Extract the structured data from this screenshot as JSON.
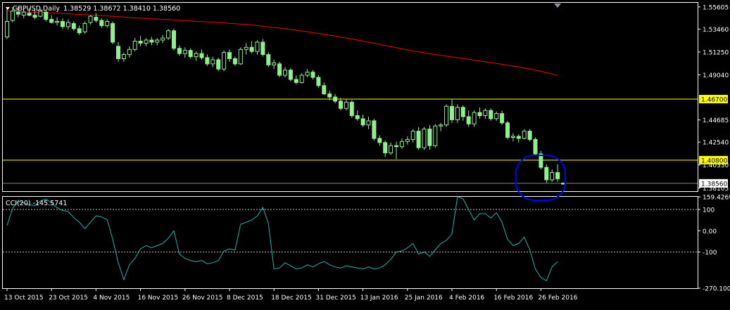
{
  "header": {
    "symbol_label": "GBPUSD,Daily",
    "ohlc_text": "1.38529 1.38672 1.38410 1.38560",
    "indicator_label": "CCI(20) -145.5741"
  },
  "colors": {
    "background": "#000000",
    "frame": "#ffffff",
    "bull_body": "#000000",
    "bear_body": "#90ee90",
    "candle_outline": "#90ee90",
    "ma_line": "#ff0000",
    "level_line": "#ffff00",
    "level_label_bg": "#ffff00",
    "cci_line": "#20b2aa",
    "ellipse": "#0000ff",
    "dotted": "#c0c0c0"
  },
  "chart_data": [
    {
      "type": "line",
      "description_visible": "Candlestick price chart with moving average",
      "title": "GBPUSD,Daily",
      "ohlc_last": {
        "open": 1.38529,
        "high": 1.38672,
        "low": 1.3841,
        "close": 1.3856
      },
      "y_range": [
        1.378,
        1.56
      ],
      "y_ticks": [
        "1.55605",
        "1.53460",
        "1.51250",
        "1.49040",
        "1.44685",
        "1.42540",
        "1.40330",
        "1.38105"
      ],
      "level_lines": [
        {
          "value": 1.467,
          "label": "1.46700"
        },
        {
          "value": 1.408,
          "label": "1.40800"
        }
      ],
      "current_price_label": "1.38560",
      "x_tick_labels": [
        {
          "index": 0,
          "label": "13 Oct 2015"
        },
        {
          "index": 8,
          "label": "23 Oct 2015"
        },
        {
          "index": 16,
          "label": "4 Nov 2015"
        },
        {
          "index": 24,
          "label": "16 Nov 2015"
        },
        {
          "index": 32,
          "label": "26 Nov 2015"
        },
        {
          "index": 40,
          "label": "8 Dec 2015"
        },
        {
          "index": 48,
          "label": "18 Dec 2015"
        },
        {
          "index": 56,
          "label": "31 Dec 2015"
        },
        {
          "index": 64,
          "label": "13 Jan 2016"
        },
        {
          "index": 72,
          "label": "25 Jan 2016"
        },
        {
          "index": 80,
          "label": "4 Feb 2016"
        },
        {
          "index": 88,
          "label": "16 Feb 2016"
        },
        {
          "index": 96,
          "label": "26 Feb 2016"
        }
      ],
      "candles": [
        {
          "o": 1.527,
          "h": 1.5545,
          "l": 1.525,
          "c": 1.542
        },
        {
          "o": 1.543,
          "h": 1.556,
          "l": 1.541,
          "c": 1.552
        },
        {
          "o": 1.551,
          "h": 1.556,
          "l": 1.546,
          "c": 1.549
        },
        {
          "o": 1.548,
          "h": 1.554,
          "l": 1.545,
          "c": 1.551
        },
        {
          "o": 1.55,
          "h": 1.555,
          "l": 1.547,
          "c": 1.548
        },
        {
          "o": 1.548,
          "h": 1.553,
          "l": 1.544,
          "c": 1.546
        },
        {
          "o": 1.547,
          "h": 1.554,
          "l": 1.546,
          "c": 1.552
        },
        {
          "o": 1.551,
          "h": 1.553,
          "l": 1.542,
          "c": 1.544
        },
        {
          "o": 1.544,
          "h": 1.548,
          "l": 1.54,
          "c": 1.541
        },
        {
          "o": 1.541,
          "h": 1.546,
          "l": 1.538,
          "c": 1.542
        },
        {
          "o": 1.542,
          "h": 1.545,
          "l": 1.535,
          "c": 1.537
        },
        {
          "o": 1.537,
          "h": 1.544,
          "l": 1.534,
          "c": 1.541
        },
        {
          "o": 1.54,
          "h": 1.542,
          "l": 1.533,
          "c": 1.535
        },
        {
          "o": 1.535,
          "h": 1.538,
          "l": 1.529,
          "c": 1.531
        },
        {
          "o": 1.532,
          "h": 1.542,
          "l": 1.53,
          "c": 1.54
        },
        {
          "o": 1.541,
          "h": 1.548,
          "l": 1.539,
          "c": 1.547
        },
        {
          "o": 1.546,
          "h": 1.55,
          "l": 1.541,
          "c": 1.543
        },
        {
          "o": 1.543,
          "h": 1.545,
          "l": 1.536,
          "c": 1.538
        },
        {
          "o": 1.538,
          "h": 1.544,
          "l": 1.536,
          "c": 1.542
        },
        {
          "o": 1.54,
          "h": 1.542,
          "l": 1.52,
          "c": 1.522
        },
        {
          "o": 1.518,
          "h": 1.522,
          "l": 1.503,
          "c": 1.506
        },
        {
          "o": 1.506,
          "h": 1.512,
          "l": 1.503,
          "c": 1.51
        },
        {
          "o": 1.51,
          "h": 1.518,
          "l": 1.507,
          "c": 1.515
        },
        {
          "o": 1.515,
          "h": 1.526,
          "l": 1.513,
          "c": 1.523
        },
        {
          "o": 1.523,
          "h": 1.528,
          "l": 1.518,
          "c": 1.521
        },
        {
          "o": 1.521,
          "h": 1.526,
          "l": 1.518,
          "c": 1.524
        },
        {
          "o": 1.524,
          "h": 1.527,
          "l": 1.519,
          "c": 1.522
        },
        {
          "o": 1.522,
          "h": 1.526,
          "l": 1.519,
          "c": 1.524
        },
        {
          "o": 1.524,
          "h": 1.529,
          "l": 1.521,
          "c": 1.526
        },
        {
          "o": 1.526,
          "h": 1.535,
          "l": 1.524,
          "c": 1.533
        },
        {
          "o": 1.533,
          "h": 1.535,
          "l": 1.514,
          "c": 1.516
        },
        {
          "o": 1.516,
          "h": 1.519,
          "l": 1.509,
          "c": 1.511
        },
        {
          "o": 1.511,
          "h": 1.517,
          "l": 1.507,
          "c": 1.514
        },
        {
          "o": 1.514,
          "h": 1.516,
          "l": 1.506,
          "c": 1.508
        },
        {
          "o": 1.508,
          "h": 1.513,
          "l": 1.504,
          "c": 1.511
        },
        {
          "o": 1.511,
          "h": 1.515,
          "l": 1.505,
          "c": 1.507
        },
        {
          "o": 1.507,
          "h": 1.51,
          "l": 1.499,
          "c": 1.501
        },
        {
          "o": 1.501,
          "h": 1.508,
          "l": 1.498,
          "c": 1.505
        },
        {
          "o": 1.505,
          "h": 1.507,
          "l": 1.494,
          "c": 1.496
        },
        {
          "o": 1.496,
          "h": 1.514,
          "l": 1.494,
          "c": 1.512
        },
        {
          "o": 1.512,
          "h": 1.515,
          "l": 1.503,
          "c": 1.506
        },
        {
          "o": 1.506,
          "h": 1.508,
          "l": 1.499,
          "c": 1.501
        },
        {
          "o": 1.501,
          "h": 1.517,
          "l": 1.5,
          "c": 1.515
        },
        {
          "o": 1.515,
          "h": 1.521,
          "l": 1.51,
          "c": 1.517
        },
        {
          "o": 1.517,
          "h": 1.523,
          "l": 1.511,
          "c": 1.513
        },
        {
          "o": 1.513,
          "h": 1.524,
          "l": 1.51,
          "c": 1.522
        },
        {
          "o": 1.522,
          "h": 1.525,
          "l": 1.508,
          "c": 1.51
        },
        {
          "o": 1.51,
          "h": 1.512,
          "l": 1.498,
          "c": 1.5
        },
        {
          "o": 1.5,
          "h": 1.505,
          "l": 1.496,
          "c": 1.502
        },
        {
          "o": 1.501,
          "h": 1.503,
          "l": 1.488,
          "c": 1.49
        },
        {
          "o": 1.49,
          "h": 1.498,
          "l": 1.488,
          "c": 1.495
        },
        {
          "o": 1.495,
          "h": 1.497,
          "l": 1.484,
          "c": 1.486
        },
        {
          "o": 1.486,
          "h": 1.49,
          "l": 1.481,
          "c": 1.483
        },
        {
          "o": 1.483,
          "h": 1.492,
          "l": 1.482,
          "c": 1.49
        },
        {
          "o": 1.49,
          "h": 1.496,
          "l": 1.488,
          "c": 1.493
        },
        {
          "o": 1.493,
          "h": 1.495,
          "l": 1.486,
          "c": 1.488
        },
        {
          "o": 1.488,
          "h": 1.49,
          "l": 1.478,
          "c": 1.48
        },
        {
          "o": 1.48,
          "h": 1.483,
          "l": 1.471,
          "c": 1.472
        },
        {
          "o": 1.472,
          "h": 1.475,
          "l": 1.466,
          "c": 1.469
        },
        {
          "o": 1.469,
          "h": 1.472,
          "l": 1.463,
          "c": 1.465
        },
        {
          "o": 1.465,
          "h": 1.468,
          "l": 1.456,
          "c": 1.458
        },
        {
          "o": 1.458,
          "h": 1.467,
          "l": 1.456,
          "c": 1.464
        },
        {
          "o": 1.464,
          "h": 1.466,
          "l": 1.449,
          "c": 1.451
        },
        {
          "o": 1.451,
          "h": 1.456,
          "l": 1.446,
          "c": 1.448
        },
        {
          "o": 1.448,
          "h": 1.452,
          "l": 1.44,
          "c": 1.442
        },
        {
          "o": 1.442,
          "h": 1.45,
          "l": 1.438,
          "c": 1.446
        },
        {
          "o": 1.446,
          "h": 1.448,
          "l": 1.427,
          "c": 1.429
        },
        {
          "o": 1.429,
          "h": 1.432,
          "l": 1.422,
          "c": 1.425
        },
        {
          "o": 1.425,
          "h": 1.427,
          "l": 1.411,
          "c": 1.415
        },
        {
          "o": 1.415,
          "h": 1.425,
          "l": 1.413,
          "c": 1.422
        },
        {
          "o": 1.422,
          "h": 1.426,
          "l": 1.409,
          "c": 1.421
        },
        {
          "o": 1.421,
          "h": 1.429,
          "l": 1.419,
          "c": 1.426
        },
        {
          "o": 1.426,
          "h": 1.431,
          "l": 1.423,
          "c": 1.428
        },
        {
          "o": 1.428,
          "h": 1.438,
          "l": 1.425,
          "c": 1.436
        },
        {
          "o": 1.436,
          "h": 1.44,
          "l": 1.418,
          "c": 1.42
        },
        {
          "o": 1.42,
          "h": 1.44,
          "l": 1.418,
          "c": 1.438
        },
        {
          "o": 1.438,
          "h": 1.442,
          "l": 1.418,
          "c": 1.422
        },
        {
          "o": 1.422,
          "h": 1.443,
          "l": 1.42,
          "c": 1.441
        },
        {
          "o": 1.441,
          "h": 1.444,
          "l": 1.436,
          "c": 1.442
        },
        {
          "o": 1.442,
          "h": 1.462,
          "l": 1.44,
          "c": 1.46
        },
        {
          "o": 1.46,
          "h": 1.467,
          "l": 1.444,
          "c": 1.447
        },
        {
          "o": 1.447,
          "h": 1.462,
          "l": 1.444,
          "c": 1.459
        },
        {
          "o": 1.459,
          "h": 1.461,
          "l": 1.446,
          "c": 1.45
        },
        {
          "o": 1.45,
          "h": 1.456,
          "l": 1.44,
          "c": 1.443
        },
        {
          "o": 1.443,
          "h": 1.456,
          "l": 1.44,
          "c": 1.454
        },
        {
          "o": 1.454,
          "h": 1.459,
          "l": 1.448,
          "c": 1.451
        },
        {
          "o": 1.451,
          "h": 1.458,
          "l": 1.448,
          "c": 1.456
        },
        {
          "o": 1.456,
          "h": 1.458,
          "l": 1.446,
          "c": 1.448
        },
        {
          "o": 1.448,
          "h": 1.455,
          "l": 1.446,
          "c": 1.453
        },
        {
          "o": 1.453,
          "h": 1.456,
          "l": 1.442,
          "c": 1.444
        },
        {
          "o": 1.444,
          "h": 1.446,
          "l": 1.428,
          "c": 1.43
        },
        {
          "o": 1.43,
          "h": 1.434,
          "l": 1.426,
          "c": 1.431
        },
        {
          "o": 1.431,
          "h": 1.433,
          "l": 1.425,
          "c": 1.429
        },
        {
          "o": 1.429,
          "h": 1.438,
          "l": 1.428,
          "c": 1.436
        },
        {
          "o": 1.436,
          "h": 1.438,
          "l": 1.426,
          "c": 1.428
        },
        {
          "o": 1.428,
          "h": 1.43,
          "l": 1.412,
          "c": 1.414
        },
        {
          "o": 1.414,
          "h": 1.417,
          "l": 1.399,
          "c": 1.401
        },
        {
          "o": 1.401,
          "h": 1.404,
          "l": 1.386,
          "c": 1.389
        },
        {
          "o": 1.389,
          "h": 1.399,
          "l": 1.387,
          "c": 1.396
        },
        {
          "o": 1.396,
          "h": 1.404,
          "l": 1.387,
          "c": 1.39
        },
        {
          "o": 1.38529,
          "h": 1.38672,
          "l": 1.3841,
          "c": 1.3856
        }
      ],
      "moving_average": [
        1.552,
        1.5518,
        1.5516,
        1.5514,
        1.5512,
        1.551,
        1.5508,
        1.5506,
        1.5503,
        1.55,
        1.5497,
        1.5494,
        1.5491,
        1.5488,
        1.5485,
        1.5482,
        1.5479,
        1.5476,
        1.5473,
        1.547,
        1.5466,
        1.5462,
        1.5458,
        1.5455,
        1.5452,
        1.5449,
        1.5446,
        1.5443,
        1.544,
        1.5437,
        1.5434,
        1.5431,
        1.5428,
        1.5425,
        1.5422,
        1.5419,
        1.5416,
        1.5413,
        1.541,
        1.5406,
        1.5402,
        1.5398,
        1.5394,
        1.539,
        1.5386,
        1.538,
        1.5374,
        1.5368,
        1.5362,
        1.5356,
        1.5349,
        1.5342,
        1.5335,
        1.5328,
        1.532,
        1.5312,
        1.5304,
        1.5296,
        1.5287,
        1.5278,
        1.5269,
        1.526,
        1.525,
        1.524,
        1.523,
        1.522,
        1.521,
        1.5199,
        1.5188,
        1.5177,
        1.5166,
        1.5155,
        1.5145,
        1.5135,
        1.5126,
        1.5117,
        1.5108,
        1.51,
        1.5092,
        1.5084,
        1.5077,
        1.507,
        1.5062,
        1.5054,
        1.5046,
        1.5038,
        1.503,
        1.5022,
        1.5014,
        1.5006,
        1.4998,
        1.4989,
        1.498,
        1.497,
        1.496,
        1.495,
        1.4938,
        1.4925,
        1.4912,
        1.4898
      ]
    },
    {
      "type": "line",
      "title": "CCI(20) -145.5741",
      "y_range": [
        -270.1005,
        159.4269
      ],
      "y_ticks": [
        "159.4269",
        "100",
        "0.00",
        "-100",
        "-270.1005"
      ],
      "dotted_levels": [
        100,
        -100
      ],
      "values": [
        25,
        105,
        140,
        130,
        122,
        118,
        140,
        150,
        130,
        108,
        95,
        90,
        62,
        40,
        10,
        40,
        70,
        65,
        52,
        -40,
        -150,
        -230,
        -160,
        -130,
        -85,
        -70,
        -80,
        -70,
        -60,
        -35,
        0,
        -110,
        -130,
        -140,
        -145,
        -140,
        -155,
        -150,
        -140,
        -95,
        -85,
        -90,
        30,
        40,
        50,
        70,
        110,
        35,
        -180,
        -175,
        -150,
        -165,
        -180,
        -175,
        -160,
        -170,
        -155,
        -145,
        -160,
        -170,
        -175,
        -165,
        -170,
        -175,
        -180,
        -170,
        -180,
        -175,
        -160,
        -135,
        -100,
        -95,
        -80,
        -60,
        -110,
        -100,
        -120,
        -90,
        -60,
        -45,
        -15,
        160,
        150,
        100,
        50,
        80,
        80,
        60,
        85,
        40,
        -40,
        -70,
        -60,
        -30,
        -90,
        -180,
        -220,
        -235,
        -170,
        -145
      ]
    }
  ]
}
